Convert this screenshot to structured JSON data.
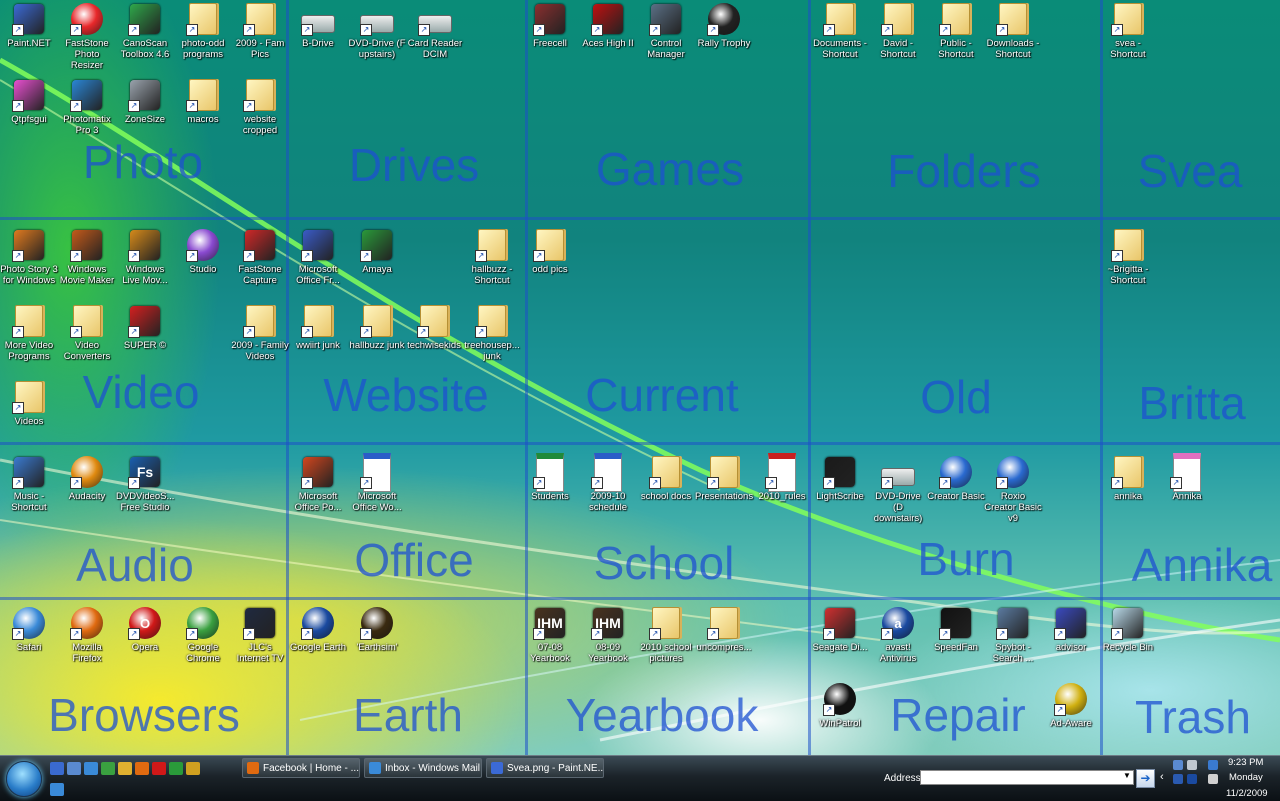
{
  "zones": [
    "Photo",
    "Drives",
    "Games",
    "Folders",
    "Svea",
    "Video",
    "Website",
    "Current",
    "Old",
    "Britta",
    "Audio",
    "Office",
    "School",
    "Burn",
    "Annika",
    "Browsers",
    "Earth",
    "Yearbook",
    "Repair",
    "Trash"
  ],
  "icons": [
    {
      "label": "Paint.NET",
      "icon": "paintnet-icon",
      "color": "#3b6ad6",
      "kind": "app"
    },
    {
      "label": "FastStone Photo Resizer",
      "icon": "faststone-resizer-icon",
      "color": "#e8282b",
      "kind": "round"
    },
    {
      "label": "CanoScan Toolbox 4.6",
      "icon": "canoscan-icon",
      "color": "#2fa84a",
      "kind": "app"
    },
    {
      "label": "photo-odd programs",
      "icon": "folder-icon",
      "kind": "folder"
    },
    {
      "label": "2009 - Fam Pics",
      "icon": "folder-icon",
      "kind": "folder"
    },
    {
      "label": "Qtpfsgui",
      "icon": "qtpfsgui-icon",
      "color": "#e84fd0",
      "kind": "app"
    },
    {
      "label": "Photomatix Pro 3",
      "icon": "photomatix-icon",
      "color": "#2a86d6",
      "kind": "app"
    },
    {
      "label": "ZoneSize",
      "icon": "zonesize-icon",
      "color": "#9aa3ad",
      "kind": "app"
    },
    {
      "label": "macros",
      "icon": "folder-icon",
      "kind": "folder"
    },
    {
      "label": "website cropped",
      "icon": "folder-icon",
      "kind": "folder"
    },
    {
      "label": "B-Drive",
      "icon": "drive-icon",
      "kind": "drive"
    },
    {
      "label": "DVD-Drive (F upstairs)",
      "icon": "dvd-drive-icon",
      "kind": "drive"
    },
    {
      "label": "Card Reader DCIM",
      "icon": "card-reader-icon",
      "kind": "drive"
    },
    {
      "label": "Freecell",
      "icon": "freecell-icon",
      "color": "#8a2f2f",
      "kind": "app"
    },
    {
      "label": "Aces High II",
      "icon": "aces-high-icon",
      "color": "#c01010",
      "kind": "app"
    },
    {
      "label": "Control Manager",
      "icon": "control-manager-icon",
      "color": "#5b7086",
      "kind": "app"
    },
    {
      "label": "Rally Trophy",
      "icon": "steering-wheel-icon",
      "color": "#222",
      "kind": "round"
    },
    {
      "label": "Documents - Shortcut",
      "icon": "documents-folder-icon",
      "kind": "folder"
    },
    {
      "label": "David - Shortcut",
      "icon": "folder-icon",
      "kind": "folder"
    },
    {
      "label": "Public - Shortcut",
      "icon": "folder-icon",
      "kind": "folder"
    },
    {
      "label": "Downloads - Shortcut",
      "icon": "downloads-folder-icon",
      "kind": "folder"
    },
    {
      "label": "svea - Shortcut",
      "icon": "folder-icon",
      "kind": "folder"
    },
    {
      "label": "Photo Story 3 for Windows",
      "icon": "photo-story-icon",
      "color": "#e07a1f",
      "kind": "app"
    },
    {
      "label": "Windows Movie Maker",
      "icon": "movie-maker-icon",
      "color": "#c45a1a",
      "kind": "app"
    },
    {
      "label": "Windows Live Mov...",
      "icon": "live-movie-icon",
      "color": "#d68a1a",
      "kind": "app"
    },
    {
      "label": "Studio",
      "icon": "studio-icon",
      "color": "#8a4ad0",
      "kind": "round"
    },
    {
      "label": "FastStone Capture",
      "icon": "faststone-capture-icon",
      "color": "#d02828",
      "kind": "app"
    },
    {
      "label": "More Video Programs",
      "icon": "folder-icon",
      "kind": "folder"
    },
    {
      "label": "Video Converters",
      "icon": "folder-icon",
      "kind": "folder"
    },
    {
      "label": "SUPER ©",
      "icon": "super-icon",
      "color": "#d42020",
      "kind": "app"
    },
    {
      "label": "2009 - Family Videos",
      "icon": "folder-icon",
      "kind": "folder"
    },
    {
      "label": "Videos",
      "icon": "folder-icon",
      "kind": "folder"
    },
    {
      "label": "Microsoft Office Fr...",
      "icon": "frontpage-icon",
      "color": "#3a5bc8",
      "kind": "app"
    },
    {
      "label": "Amaya",
      "icon": "amaya-icon",
      "color": "#2a9a3a",
      "kind": "app"
    },
    {
      "label": "hallbuzz - Shortcut",
      "icon": "web-folder-icon",
      "kind": "folder"
    },
    {
      "label": "wwiirt junk",
      "icon": "folder-icon",
      "kind": "folder"
    },
    {
      "label": "hallbuzz junk",
      "icon": "folder-icon",
      "kind": "folder"
    },
    {
      "label": "techwisekids",
      "icon": "folder-icon",
      "kind": "folder"
    },
    {
      "label": "treehousep... junk",
      "icon": "folder-icon",
      "kind": "folder"
    },
    {
      "label": "odd pics",
      "icon": "folder-icon",
      "kind": "folder"
    },
    {
      "label": "~Brigitta - Shortcut",
      "icon": "folder-icon",
      "kind": "folder"
    },
    {
      "label": "Music - Shortcut",
      "icon": "music-icon",
      "color": "#3a7ad0",
      "kind": "app"
    },
    {
      "label": "Audacity",
      "icon": "audacity-icon",
      "color": "#e08a10",
      "kind": "round"
    },
    {
      "label": "DVDVideoS... Free Studio",
      "icon": "dvdvideosoft-icon",
      "color": "#1a5fb0",
      "kind": "app",
      "text": "Fs"
    },
    {
      "label": "Microsoft Office Po...",
      "icon": "powerpoint-icon",
      "color": "#d2461e",
      "kind": "app"
    },
    {
      "label": "Microsoft Office Wo...",
      "icon": "word-icon",
      "color": "#2a5cc8",
      "kind": "doc"
    },
    {
      "label": "Students",
      "icon": "excel-doc-icon",
      "color": "#1f8a3a",
      "kind": "doc"
    },
    {
      "label": "2009-10 schedule",
      "icon": "word-doc-icon",
      "color": "#2a5cc8",
      "kind": "doc"
    },
    {
      "label": "school docs",
      "icon": "folder-icon",
      "kind": "folder"
    },
    {
      "label": "Presentations",
      "icon": "folder-icon",
      "kind": "folder"
    },
    {
      "label": "2010_rules",
      "icon": "pdf-doc-icon",
      "color": "#c82020",
      "kind": "doc"
    },
    {
      "label": "LightScribe",
      "icon": "lightscribe-icon",
      "color": "#1a1a1a",
      "kind": "app"
    },
    {
      "label": "DVD-Drive (D downstairs)",
      "icon": "dvd-drive-icon",
      "kind": "drive"
    },
    {
      "label": "Creator Basic",
      "icon": "roxio-creator-icon",
      "color": "#2a6ad0",
      "kind": "round"
    },
    {
      "label": "Roxio Creator Basic v9",
      "icon": "roxio-creator-icon",
      "color": "#2a6ad0",
      "kind": "round"
    },
    {
      "label": "annika",
      "icon": "folder-icon",
      "kind": "folder"
    },
    {
      "label": "Annika",
      "icon": "image-file-icon",
      "color": "#e070c0",
      "kind": "doc"
    },
    {
      "label": "Safari",
      "icon": "safari-icon",
      "color": "#3a8ad8",
      "kind": "round"
    },
    {
      "label": "Mozilla Firefox",
      "icon": "firefox-icon",
      "color": "#e06a10",
      "kind": "round"
    },
    {
      "label": "Opera",
      "icon": "opera-icon",
      "color": "#d01818",
      "kind": "round",
      "text": "O"
    },
    {
      "label": "Google Chrome",
      "icon": "chrome-icon",
      "color": "#3aa040",
      "kind": "round"
    },
    {
      "label": "JLC's Internet TV",
      "icon": "internet-tv-icon",
      "color": "#202a40",
      "kind": "app"
    },
    {
      "label": "Google Earth",
      "icon": "google-earth-icon",
      "color": "#1a4aa0",
      "kind": "round"
    },
    {
      "label": "'Earthsim'",
      "icon": "earthsim-icon",
      "color": "#3a2a10",
      "kind": "round"
    },
    {
      "label": "07-08 Yearbook",
      "icon": "yearbook-shield-icon",
      "color": "#4a3320",
      "kind": "app",
      "text": "IHM"
    },
    {
      "label": "08-09 Yearbook",
      "icon": "yearbook-shield-icon",
      "color": "#4a3320",
      "kind": "app",
      "text": "IHM"
    },
    {
      "label": "2010 school pictures",
      "icon": "folder-icon",
      "kind": "folder"
    },
    {
      "label": "uncompres...",
      "icon": "folder-icon",
      "kind": "folder"
    },
    {
      "label": "Seagate Di...",
      "icon": "seagate-icon",
      "color": "#d03030",
      "kind": "app"
    },
    {
      "label": "avast! Antivirus",
      "icon": "avast-icon",
      "color": "#1a4aa0",
      "kind": "round",
      "text": "a"
    },
    {
      "label": "SpeedFan",
      "icon": "speedfan-icon",
      "color": "#111",
      "kind": "app"
    },
    {
      "label": "Spybot - Search ...",
      "icon": "spybot-icon",
      "color": "#5a7aa0",
      "kind": "app"
    },
    {
      "label": "advisor",
      "icon": "advisor-icon",
      "color": "#3a4ac0",
      "kind": "app"
    },
    {
      "label": "Recycle Bin",
      "icon": "recycle-bin-icon",
      "color": "#b8d8e8",
      "kind": "app"
    },
    {
      "label": "WinPatrol",
      "icon": "winpatrol-icon",
      "color": "#111",
      "kind": "round"
    },
    {
      "label": "Ad-Aware",
      "icon": "ad-aware-icon",
      "color": "#d0b010",
      "kind": "round"
    }
  ],
  "taskbar": {
    "quicklaunch": [
      "show-desktop-icon",
      "switch-windows-icon",
      "ie-icon",
      "chrome-icon",
      "folder-icon",
      "firefox-icon",
      "opera-icon",
      "media-icon",
      "explorer-icon",
      "ie-icon"
    ],
    "tasks": [
      {
        "label": "Facebook | Home - ...",
        "icon": "firefox-icon",
        "color": "#e06a10"
      },
      {
        "label": "Inbox - Windows Mail",
        "icon": "mail-icon",
        "color": "#3a8ad8"
      },
      {
        "label": "Svea.png - Paint.NE...",
        "icon": "paintnet-icon",
        "color": "#3b6ad6"
      }
    ],
    "address_label": "Address",
    "address_value": "",
    "clock_time": "9:23 PM",
    "clock_day": "Monday",
    "clock_date": "11/2/2009"
  }
}
